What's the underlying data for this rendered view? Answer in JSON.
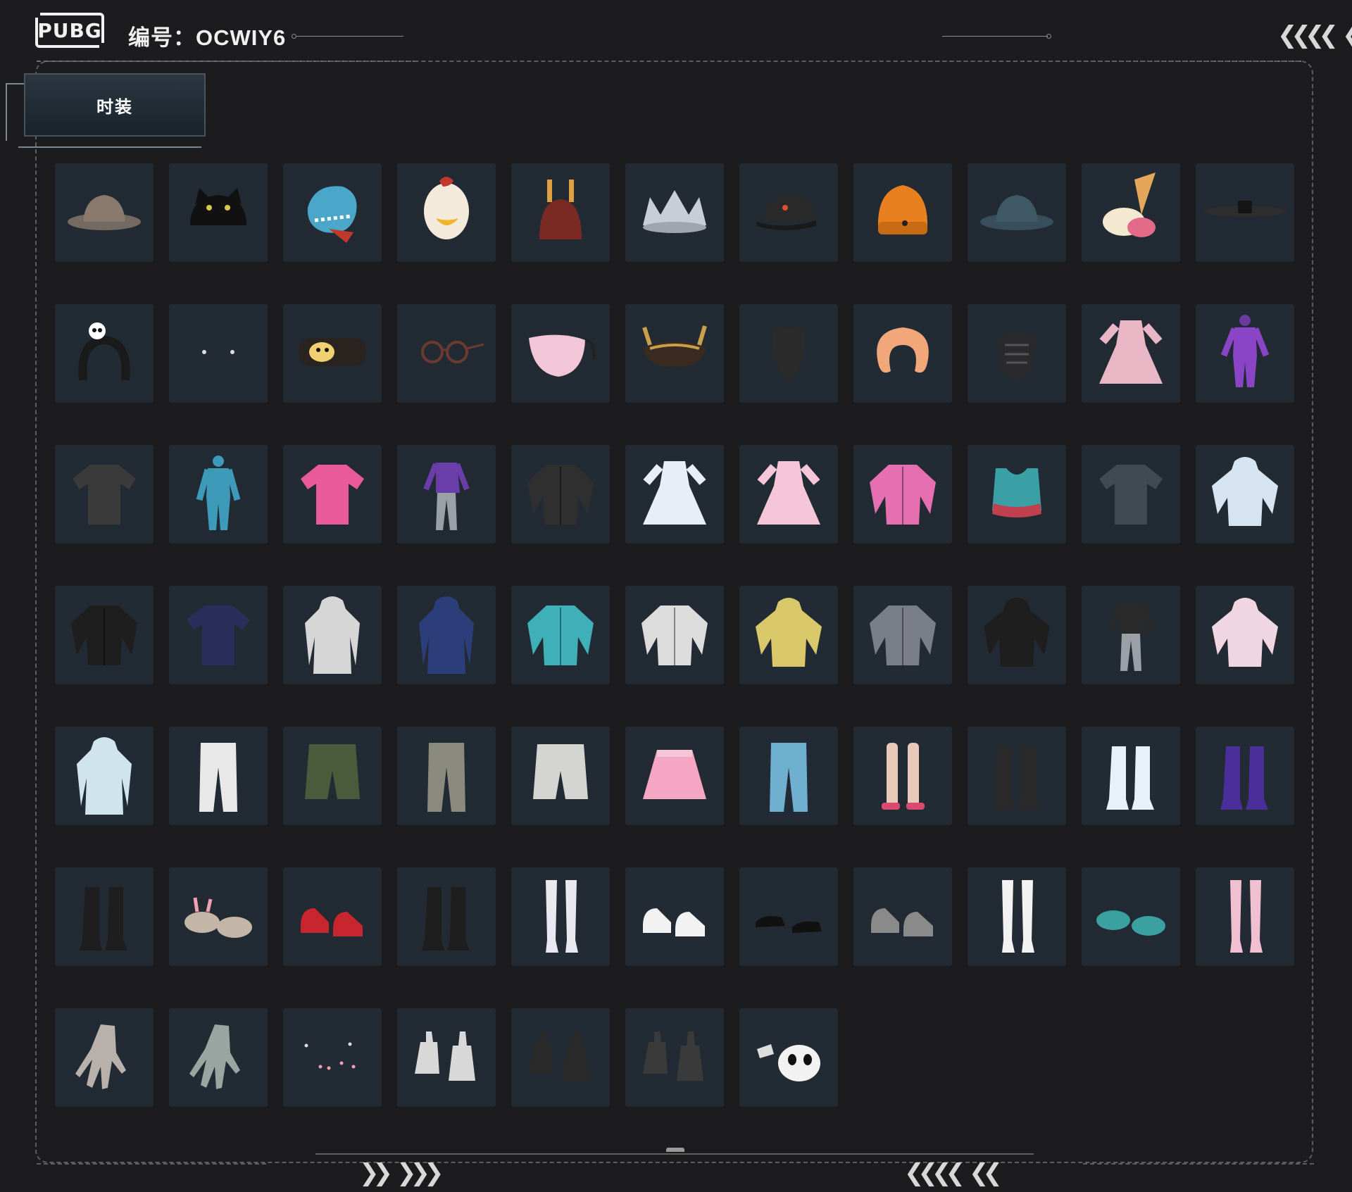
{
  "header": {
    "logo_text": "PUBG",
    "code_label": "编号：",
    "code_value": "OCWIY6",
    "nav_left_icon": "triple-chevron-left-icon"
  },
  "tabs": [
    {
      "label": "时装",
      "selected": true
    }
  ],
  "items": [
    {
      "name": "bucket-hat",
      "icon": "bucket-hat-icon"
    },
    {
      "name": "cat-ear-beanie",
      "icon": "cat-beanie-icon"
    },
    {
      "name": "dinosaur-mask",
      "icon": "dino-mask-icon"
    },
    {
      "name": "chicken-mask",
      "icon": "chicken-mask-icon"
    },
    {
      "name": "antler-cap",
      "icon": "antler-hat-icon"
    },
    {
      "name": "silver-crown",
      "icon": "crown-icon"
    },
    {
      "name": "black-baseball-cap",
      "icon": "cap-icon"
    },
    {
      "name": "orange-beanie",
      "icon": "beanie-icon"
    },
    {
      "name": "teal-bucket-hat",
      "icon": "bucket-hat-icon"
    },
    {
      "name": "ice-cream-cone-hat",
      "icon": "ice-cream-icon"
    },
    {
      "name": "black-wide-brim-hat",
      "icon": "wide-hat-icon"
    },
    {
      "name": "panda-headband",
      "icon": "headband-icon"
    },
    {
      "name": "earrings",
      "icon": "earrings-icon"
    },
    {
      "name": "bear-eye-mask",
      "icon": "eye-mask-icon"
    },
    {
      "name": "round-sunglasses",
      "icon": "glasses-icon"
    },
    {
      "name": "pink-face-mask",
      "icon": "face-mask-icon"
    },
    {
      "name": "golden-horn-mask",
      "icon": "horn-mask-icon"
    },
    {
      "name": "black-bandana",
      "icon": "bandana-icon"
    },
    {
      "name": "neck-pillow",
      "icon": "neck-pillow-icon"
    },
    {
      "name": "tactical-face-guard",
      "icon": "face-guard-icon"
    },
    {
      "name": "pink-ruffle-dress",
      "icon": "dress-icon"
    },
    {
      "name": "purple-bodysuit",
      "icon": "bodysuit-icon"
    },
    {
      "name": "gray-long-sleeve",
      "icon": "shirt-icon"
    },
    {
      "name": "blue-onesie",
      "icon": "onesie-icon"
    },
    {
      "name": "pink-denim-top",
      "icon": "shirt-icon"
    },
    {
      "name": "purple-outfit",
      "icon": "outfit-icon"
    },
    {
      "name": "black-leather-jacket",
      "icon": "jacket-icon"
    },
    {
      "name": "white-frilly-dress",
      "icon": "dress-icon"
    },
    {
      "name": "pink-qipao",
      "icon": "dress-icon"
    },
    {
      "name": "pink-black-jacket",
      "icon": "jacket-icon"
    },
    {
      "name": "teal-crop-top",
      "icon": "crop-top-icon"
    },
    {
      "name": "floral-shirt",
      "icon": "shirt-icon"
    },
    {
      "name": "white-fluffy-hoodie",
      "icon": "hoodie-icon"
    },
    {
      "name": "black-hooded-jacket",
      "icon": "jacket-icon"
    },
    {
      "name": "navy-sweatshirt",
      "icon": "shirt-icon"
    },
    {
      "name": "long-graphic-coat",
      "icon": "coat-icon"
    },
    {
      "name": "blue-trench-coat",
      "icon": "coat-icon"
    },
    {
      "name": "teal-parka",
      "icon": "jacket-icon"
    },
    {
      "name": "moto-jacket",
      "icon": "jacket-icon"
    },
    {
      "name": "yellow-chicken-hoodie",
      "icon": "hoodie-icon"
    },
    {
      "name": "orange-gray-jacket",
      "icon": "jacket-icon"
    },
    {
      "name": "black-hoodie",
      "icon": "hoodie-icon"
    },
    {
      "name": "black-suit",
      "icon": "outfit-icon"
    },
    {
      "name": "pink-white-jacket",
      "icon": "hoodie-icon"
    },
    {
      "name": "white-hooded-coat",
      "icon": "coat-icon"
    },
    {
      "name": "white-black-pants",
      "icon": "pants-icon"
    },
    {
      "name": "green-shorts",
      "icon": "shorts-icon"
    },
    {
      "name": "cargo-pants",
      "icon": "pants-icon"
    },
    {
      "name": "white-shorts",
      "icon": "shorts-icon"
    },
    {
      "name": "pink-pleated-skirt",
      "icon": "skirt-icon"
    },
    {
      "name": "light-blue-pants",
      "icon": "pants-icon"
    },
    {
      "name": "knee-socks-pink-shoes",
      "icon": "socks-icon"
    },
    {
      "name": "black-leg-warmers",
      "icon": "boots-icon"
    },
    {
      "name": "white-fluffy-boots",
      "icon": "boots-icon"
    },
    {
      "name": "purple-boots",
      "icon": "boots-icon"
    },
    {
      "name": "black-lace-up-boots",
      "icon": "boots-icon"
    },
    {
      "name": "bunny-slippers",
      "icon": "slipper-icon"
    },
    {
      "name": "red-high-tops",
      "icon": "sneaker-icon"
    },
    {
      "name": "black-combat-boots",
      "icon": "boots-icon"
    },
    {
      "name": "white-thigh-high-boots",
      "icon": "stockings-icon"
    },
    {
      "name": "white-sneakers",
      "icon": "sneaker-icon"
    },
    {
      "name": "black-dress-shoes",
      "icon": "dress-shoe-icon"
    },
    {
      "name": "gray-sneakers",
      "icon": "sneaker-icon"
    },
    {
      "name": "white-stockings",
      "icon": "stockings-icon"
    },
    {
      "name": "teal-clogs",
      "icon": "clog-icon"
    },
    {
      "name": "fishnet-pink-boots",
      "icon": "stockings-icon"
    },
    {
      "name": "pink-nail-hand",
      "icon": "hand-icon"
    },
    {
      "name": "ring-hand",
      "icon": "hand-icon"
    },
    {
      "name": "nail-set",
      "icon": "nails-icon"
    },
    {
      "name": "skeleton-gloves",
      "icon": "glove-icon"
    },
    {
      "name": "golden-claw-gloves",
      "icon": "glove-icon"
    },
    {
      "name": "tactical-gloves",
      "icon": "glove-icon"
    },
    {
      "name": "panda-backpack",
      "icon": "panda-bag-icon"
    }
  ],
  "palette": {
    "background": "#1c1c1e",
    "cell": "#222a33",
    "tab_top": "#2b3640",
    "tab_bottom": "#1a232c",
    "dash": "#5d5d5d",
    "text": "#f0f0f0"
  }
}
